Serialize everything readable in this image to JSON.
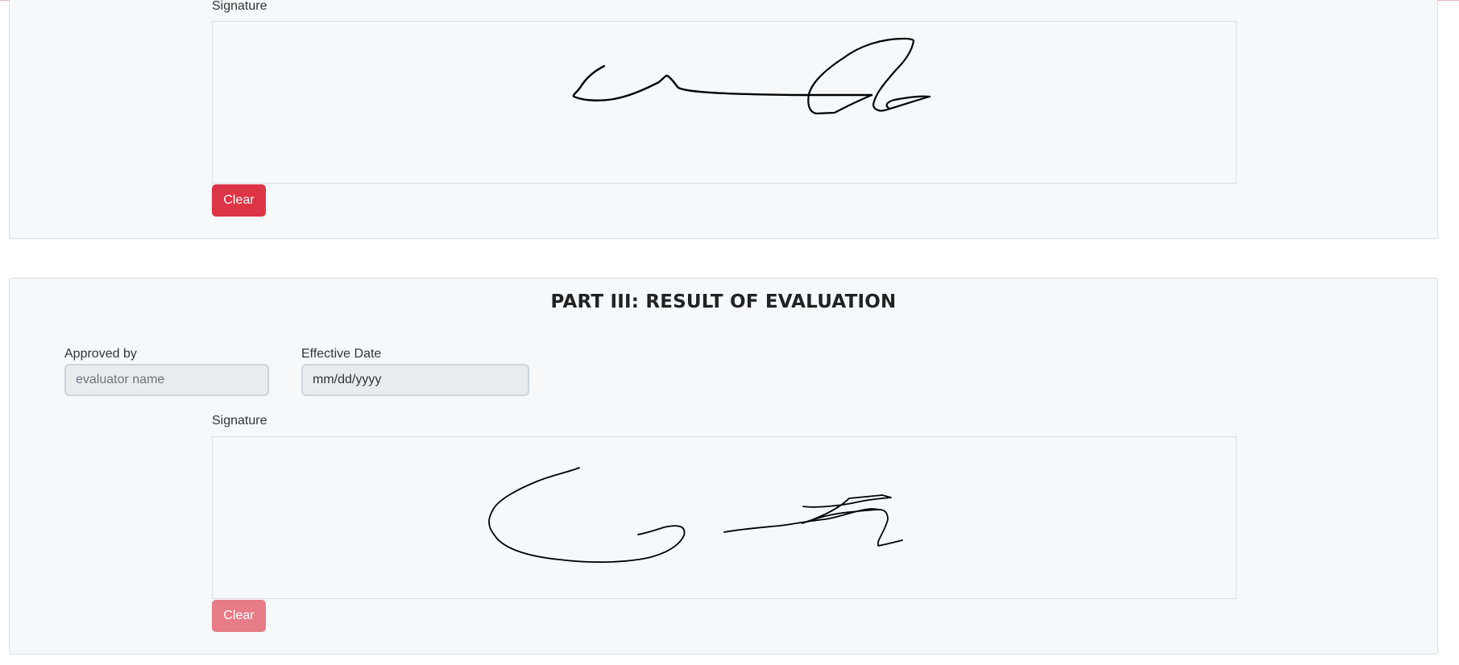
{
  "signature_section_top": {
    "signature_label": "Signature",
    "clear_label": "Clear"
  },
  "part_three": {
    "title": "PART III: RESULT OF EVALUATION",
    "approved_by": {
      "label": "Approved by",
      "value": "",
      "placeholder": "evaluator name"
    },
    "effective_date": {
      "label": "Effective Date",
      "value": "",
      "placeholder": "mm/dd/yyyy"
    },
    "signature_label": "Signature",
    "clear_label": "Clear"
  },
  "colors": {
    "clear_button_active": "#dc3545",
    "clear_button_disabled": "#e77c86",
    "panel_background": "#f7f8fa",
    "input_background": "#e9ecef"
  }
}
